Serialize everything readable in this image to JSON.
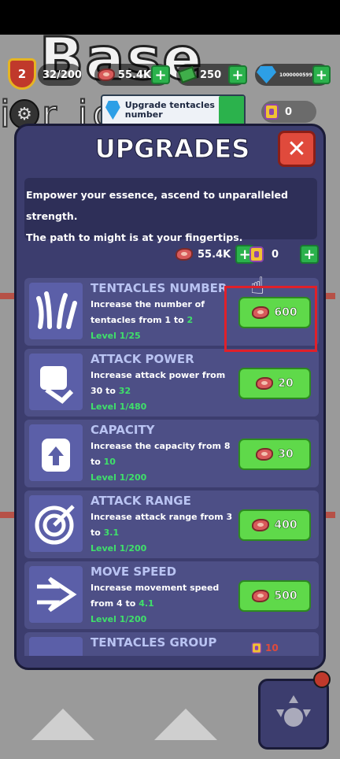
{
  "hud": {
    "level": "2",
    "population": "32/200",
    "meat": "55.4K",
    "cash": "250",
    "gems": "1000000599",
    "scrolls": "0"
  },
  "background": {
    "title": "Base",
    "subtitle": "ier ios"
  },
  "notice": {
    "text": "Upgrade tentacles number"
  },
  "modal": {
    "title": "UPGRADES",
    "close_label": "✕",
    "description_line1": "Empower your essence, ascend to unparalleled strength.",
    "description_line2": "The path to might is at your fingertips.",
    "meat_amount": "55.4K",
    "scroll_amount": "0"
  },
  "upgrades": [
    {
      "name": "TENTACLES NUMBER",
      "desc_prefix": "Increase the number of tentacles from 1 to ",
      "desc_target": "2",
      "level": "Level 1/25",
      "price": "600",
      "icon": "tentacles-icon"
    },
    {
      "name": "ATTACK POWER",
      "desc_prefix": "Increase attack power from 30 to ",
      "desc_target": "32",
      "level": "Level 1/480",
      "price": "20",
      "icon": "fist-icon"
    },
    {
      "name": "CAPACITY",
      "desc_prefix": "Increase the capacity from 8 to ",
      "desc_target": "10",
      "level": "Level 1/200",
      "price": "30",
      "icon": "backpack-icon"
    },
    {
      "name": "ATTACK RANGE",
      "desc_prefix": "Increase attack range from 3 to ",
      "desc_target": "3.1",
      "level": "Level 1/200",
      "price": "400",
      "icon": "target-icon"
    },
    {
      "name": "MOVE SPEED",
      "desc_prefix": "Increase movement speed from 4 to ",
      "desc_target": "4.1",
      "level": "Level 1/200",
      "price": "500",
      "icon": "speed-arrow-icon"
    },
    {
      "name": "TENTACLES GROUP",
      "price": "10",
      "icon": "tentacles-group-icon"
    }
  ]
}
